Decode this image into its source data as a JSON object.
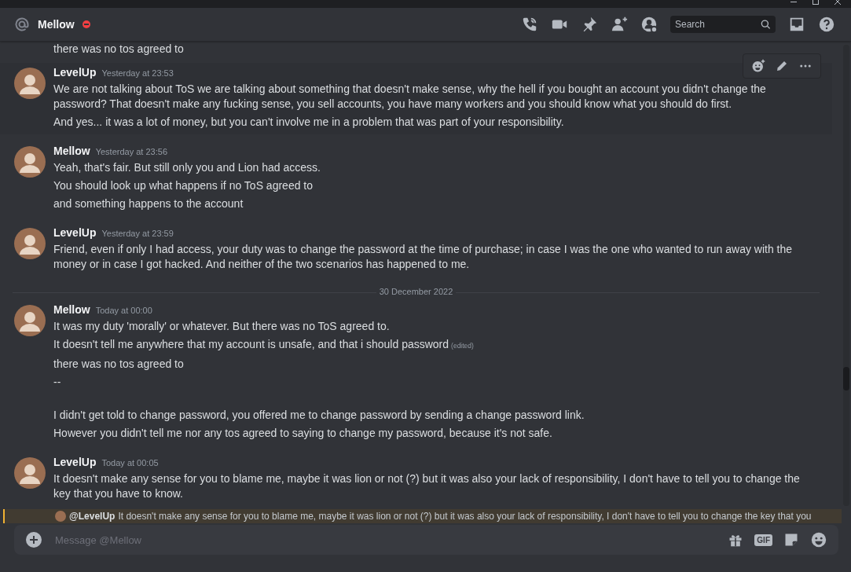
{
  "header": {
    "recipient": "Mellow",
    "search_placeholder": "Search"
  },
  "top_fragment": "there was no tos agreed to",
  "messages": [
    {
      "kind": "group",
      "author": "LevelUp",
      "timestamp": "Yesterday at 23:53",
      "hovered": true,
      "lines": [
        {
          "text": "We are not talking about ToS we are talking about something that doesn't make sense, why the hell if you bought an account you didn't change the password? That doesn't make any fucking sense, you sell accounts, you have many workers and you should know what you should do first."
        },
        {
          "text": "And yes... it was a lot of money, but you can't involve me in a problem that was part of your responsibility."
        }
      ]
    },
    {
      "kind": "group",
      "author": "Mellow",
      "timestamp": "Yesterday at 23:56",
      "hovered": false,
      "lines": [
        {
          "text": "Yeah, that's fair. But still only you and Lion had access."
        },
        {
          "text": "You should look up what happens if no ToS agreed to"
        },
        {
          "text": "and something happens to the account"
        }
      ]
    },
    {
      "kind": "group",
      "author": "LevelUp",
      "timestamp": "Yesterday at 23:59",
      "hovered": false,
      "lines": [
        {
          "text": "Friend, even if only I had access, your duty was to change the password at the time of purchase; in case I was the one who wanted to run away with the money or in case I got hacked. And neither of the two scenarios has happened to me."
        }
      ]
    },
    {
      "kind": "divider",
      "label": "30 December 2022"
    },
    {
      "kind": "group",
      "author": "Mellow",
      "timestamp": "Today at 00:00",
      "hovered": false,
      "lines": [
        {
          "text": "It was my duty 'morally' or whatever. But there was no ToS agreed to."
        },
        {
          "text": "It doesn't tell me anywhere that my account is unsafe, and that i should password",
          "edited": "(edited)"
        },
        {
          "text": "there was no tos agreed to"
        },
        {
          "text": "--",
          "gap_after": true
        },
        {
          "text": "I didn't get told to change password, you offered me to change password by sending a change password link."
        },
        {
          "text": "However you didn't tell me nor any tos agreed to saying to change my password, because it's not safe."
        }
      ]
    },
    {
      "kind": "group",
      "author": "LevelUp",
      "timestamp": "Today at 00:05",
      "hovered": false,
      "lines": [
        {
          "text": "It doesn't make any sense for you to blame me, maybe it was lion or not (?) but it was also your lack of responsibility, I don't have to tell you to change the key that you have to know."
        }
      ]
    }
  ],
  "reply_preview": {
    "author": "@LevelUp",
    "text": "It doesn't make any sense for you to blame me, maybe it was lion or not (?) but it was also your lack of responsibility, I don't have to tell you to change the key that you"
  },
  "composer": {
    "placeholder": "Message @Mellow",
    "gif_label": "GIF"
  }
}
